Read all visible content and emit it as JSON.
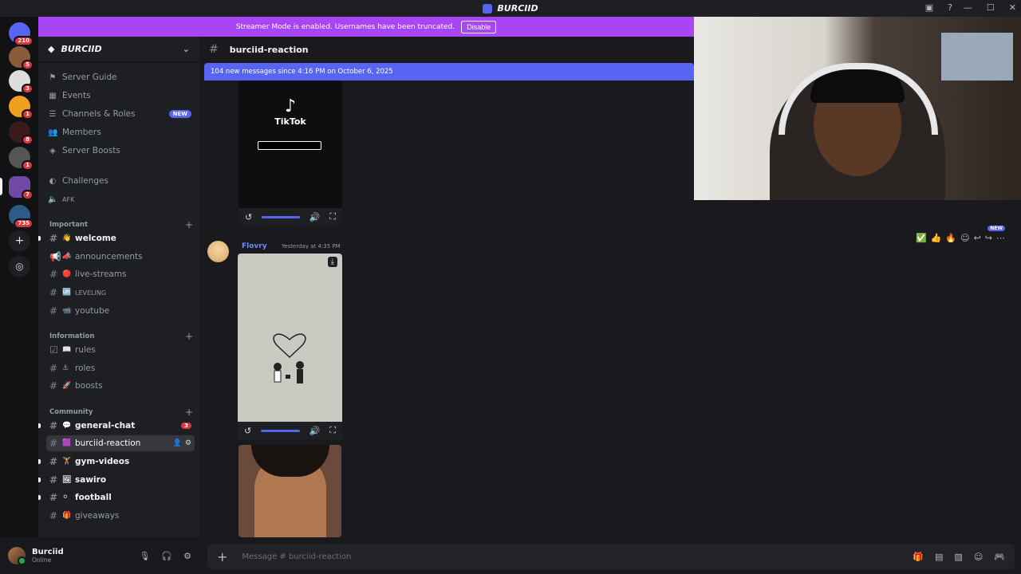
{
  "window": {
    "title": "BURCIID"
  },
  "banner": {
    "text": "Streamer Mode is enabled. Usernames have been truncated.",
    "button": "Disable"
  },
  "guild_badges": [
    "210",
    "5",
    "3",
    "1",
    "8",
    "1",
    "7",
    "735"
  ],
  "server": {
    "name": "BURCIID"
  },
  "nav": [
    {
      "label": "Server Guide",
      "icon": "signpost-icon"
    },
    {
      "label": "Events",
      "icon": "calendar-icon"
    },
    {
      "label": "Channels & Roles",
      "icon": "list-icon",
      "badge": "NEW"
    },
    {
      "label": "Members",
      "icon": "members-icon"
    },
    {
      "label": "Server Boosts",
      "icon": "boost-icon"
    }
  ],
  "extra_nav": [
    {
      "label": "Challenges",
      "icon": "challenge-icon"
    },
    {
      "label": "AFK",
      "icon": "speaker-icon"
    }
  ],
  "categories": {
    "important": "Important",
    "information": "Information",
    "community": "Community"
  },
  "channels": [
    {
      "name": "welcome",
      "emoji": "👋",
      "unread": true
    },
    {
      "name": "announcements",
      "emoji": "📣"
    },
    {
      "name": "live-streams",
      "emoji": "🔴"
    },
    {
      "name": "LEVELING",
      "emoji": "🆙"
    },
    {
      "name": "youtube",
      "emoji": "📹"
    },
    {
      "name": "rules",
      "emoji": "📖"
    },
    {
      "name": "roles",
      "emoji": "⚓"
    },
    {
      "name": "boosts",
      "emoji": "🚀"
    },
    {
      "name": "general-chat",
      "emoji": "💬",
      "count": "3",
      "unread": true
    },
    {
      "name": "burciid-reaction",
      "emoji": "🟪",
      "active": true
    },
    {
      "name": "gym-videos",
      "emoji": "🏋",
      "unread": true
    },
    {
      "name": "sawiro",
      "emoji": "🖼",
      "unread": true
    },
    {
      "name": "football",
      "emoji": "⚪",
      "unread": true
    },
    {
      "name": "giveaways",
      "emoji": "🎁"
    }
  ],
  "user": {
    "name": "Burciid",
    "status": "Online"
  },
  "channel_header": {
    "name": "burciid-reaction"
  },
  "new_messages": "104 new messages since 4:16 PM on October 6, 2025",
  "message": {
    "author": "Flovry",
    "time": "Yesterday at 4:35 PM"
  },
  "tiktok": {
    "label": "TikTok"
  },
  "toolbar": {
    "new": "NEW"
  },
  "composer": {
    "placeholder": "Message # burciid-reaction"
  }
}
